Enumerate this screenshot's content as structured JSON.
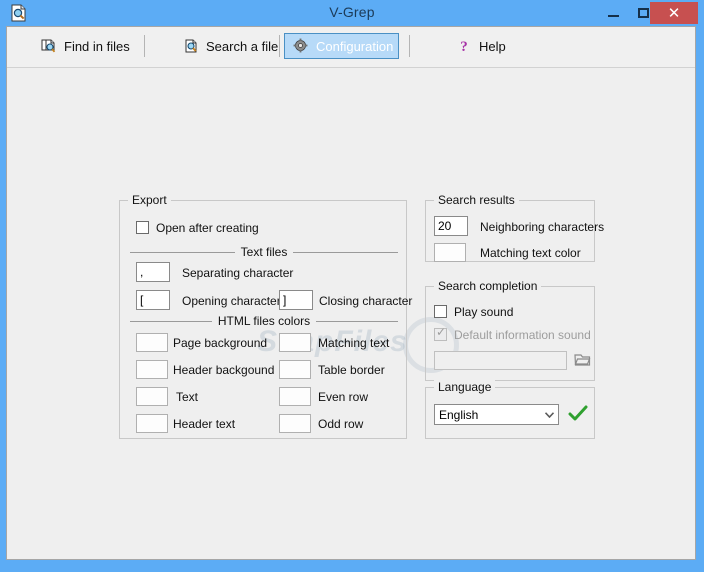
{
  "window": {
    "title": "V-Grep",
    "icon": "document-search-icon",
    "controls": {
      "minimize": "–",
      "maximize": "▭",
      "close": "✕"
    },
    "colors": {
      "title_bar": "#5cacf5",
      "close_button": "#c75050",
      "client_background": "#efefef",
      "selected_tab": "#b7daf8",
      "selected_tab_border": "#4a90c4"
    }
  },
  "toolbar": {
    "items": [
      {
        "label": "Find in files",
        "icon": "find-in-files-icon",
        "selected": false
      },
      {
        "label": "Search a file",
        "icon": "search-a-file-icon",
        "selected": false
      },
      {
        "label": "Configuration",
        "icon": "gear-icon",
        "selected": true
      },
      {
        "label": "Help",
        "icon": "question-mark-icon",
        "selected": false
      }
    ]
  },
  "export": {
    "title": "Export",
    "open_after_creating": {
      "label": "Open after creating",
      "checked": false
    },
    "text_files": {
      "section_label": "Text files",
      "separating_character": {
        "value": ",",
        "label": "Separating character"
      },
      "opening_character": {
        "value": "[",
        "label": "Opening character"
      },
      "closing_character": {
        "value": "]",
        "label": "Closing character"
      }
    },
    "html_files_colors": {
      "section_label": "HTML files colors",
      "left": [
        {
          "label": "Page background",
          "color": "#fdfdfd"
        },
        {
          "label": "Header backgound",
          "color": "#fdfdfd"
        },
        {
          "label": "Text",
          "color": "#fdfdfd"
        },
        {
          "label": "Header text",
          "color": "#fdfdfd"
        }
      ],
      "right": [
        {
          "label": "Matching text",
          "color": "#fdfdfd"
        },
        {
          "label": "Table border",
          "color": "#fdfdfd"
        },
        {
          "label": "Even row",
          "color": "#fdfdfd"
        },
        {
          "label": "Odd row",
          "color": "#fdfdfd"
        }
      ]
    }
  },
  "search_results": {
    "title": "Search results",
    "neighboring_characters": {
      "value": "20",
      "label": "Neighboring characters"
    },
    "matching_text_color": {
      "label": "Matching text color",
      "color": "#fdfdfd"
    }
  },
  "search_completion": {
    "title": "Search completion",
    "play_sound": {
      "label": "Play sound",
      "checked": false,
      "disabled": false
    },
    "default_information_sound": {
      "label": "Default information sound",
      "checked": true,
      "disabled": true
    },
    "sound_file": {
      "value": "",
      "disabled": true
    },
    "browse_button": {
      "icon": "open-folder-icon"
    }
  },
  "language": {
    "title": "Language",
    "selected": "English",
    "options": [
      "English"
    ],
    "apply_icon": "green-check-icon"
  },
  "watermark": {
    "text": "SnapFiles"
  }
}
